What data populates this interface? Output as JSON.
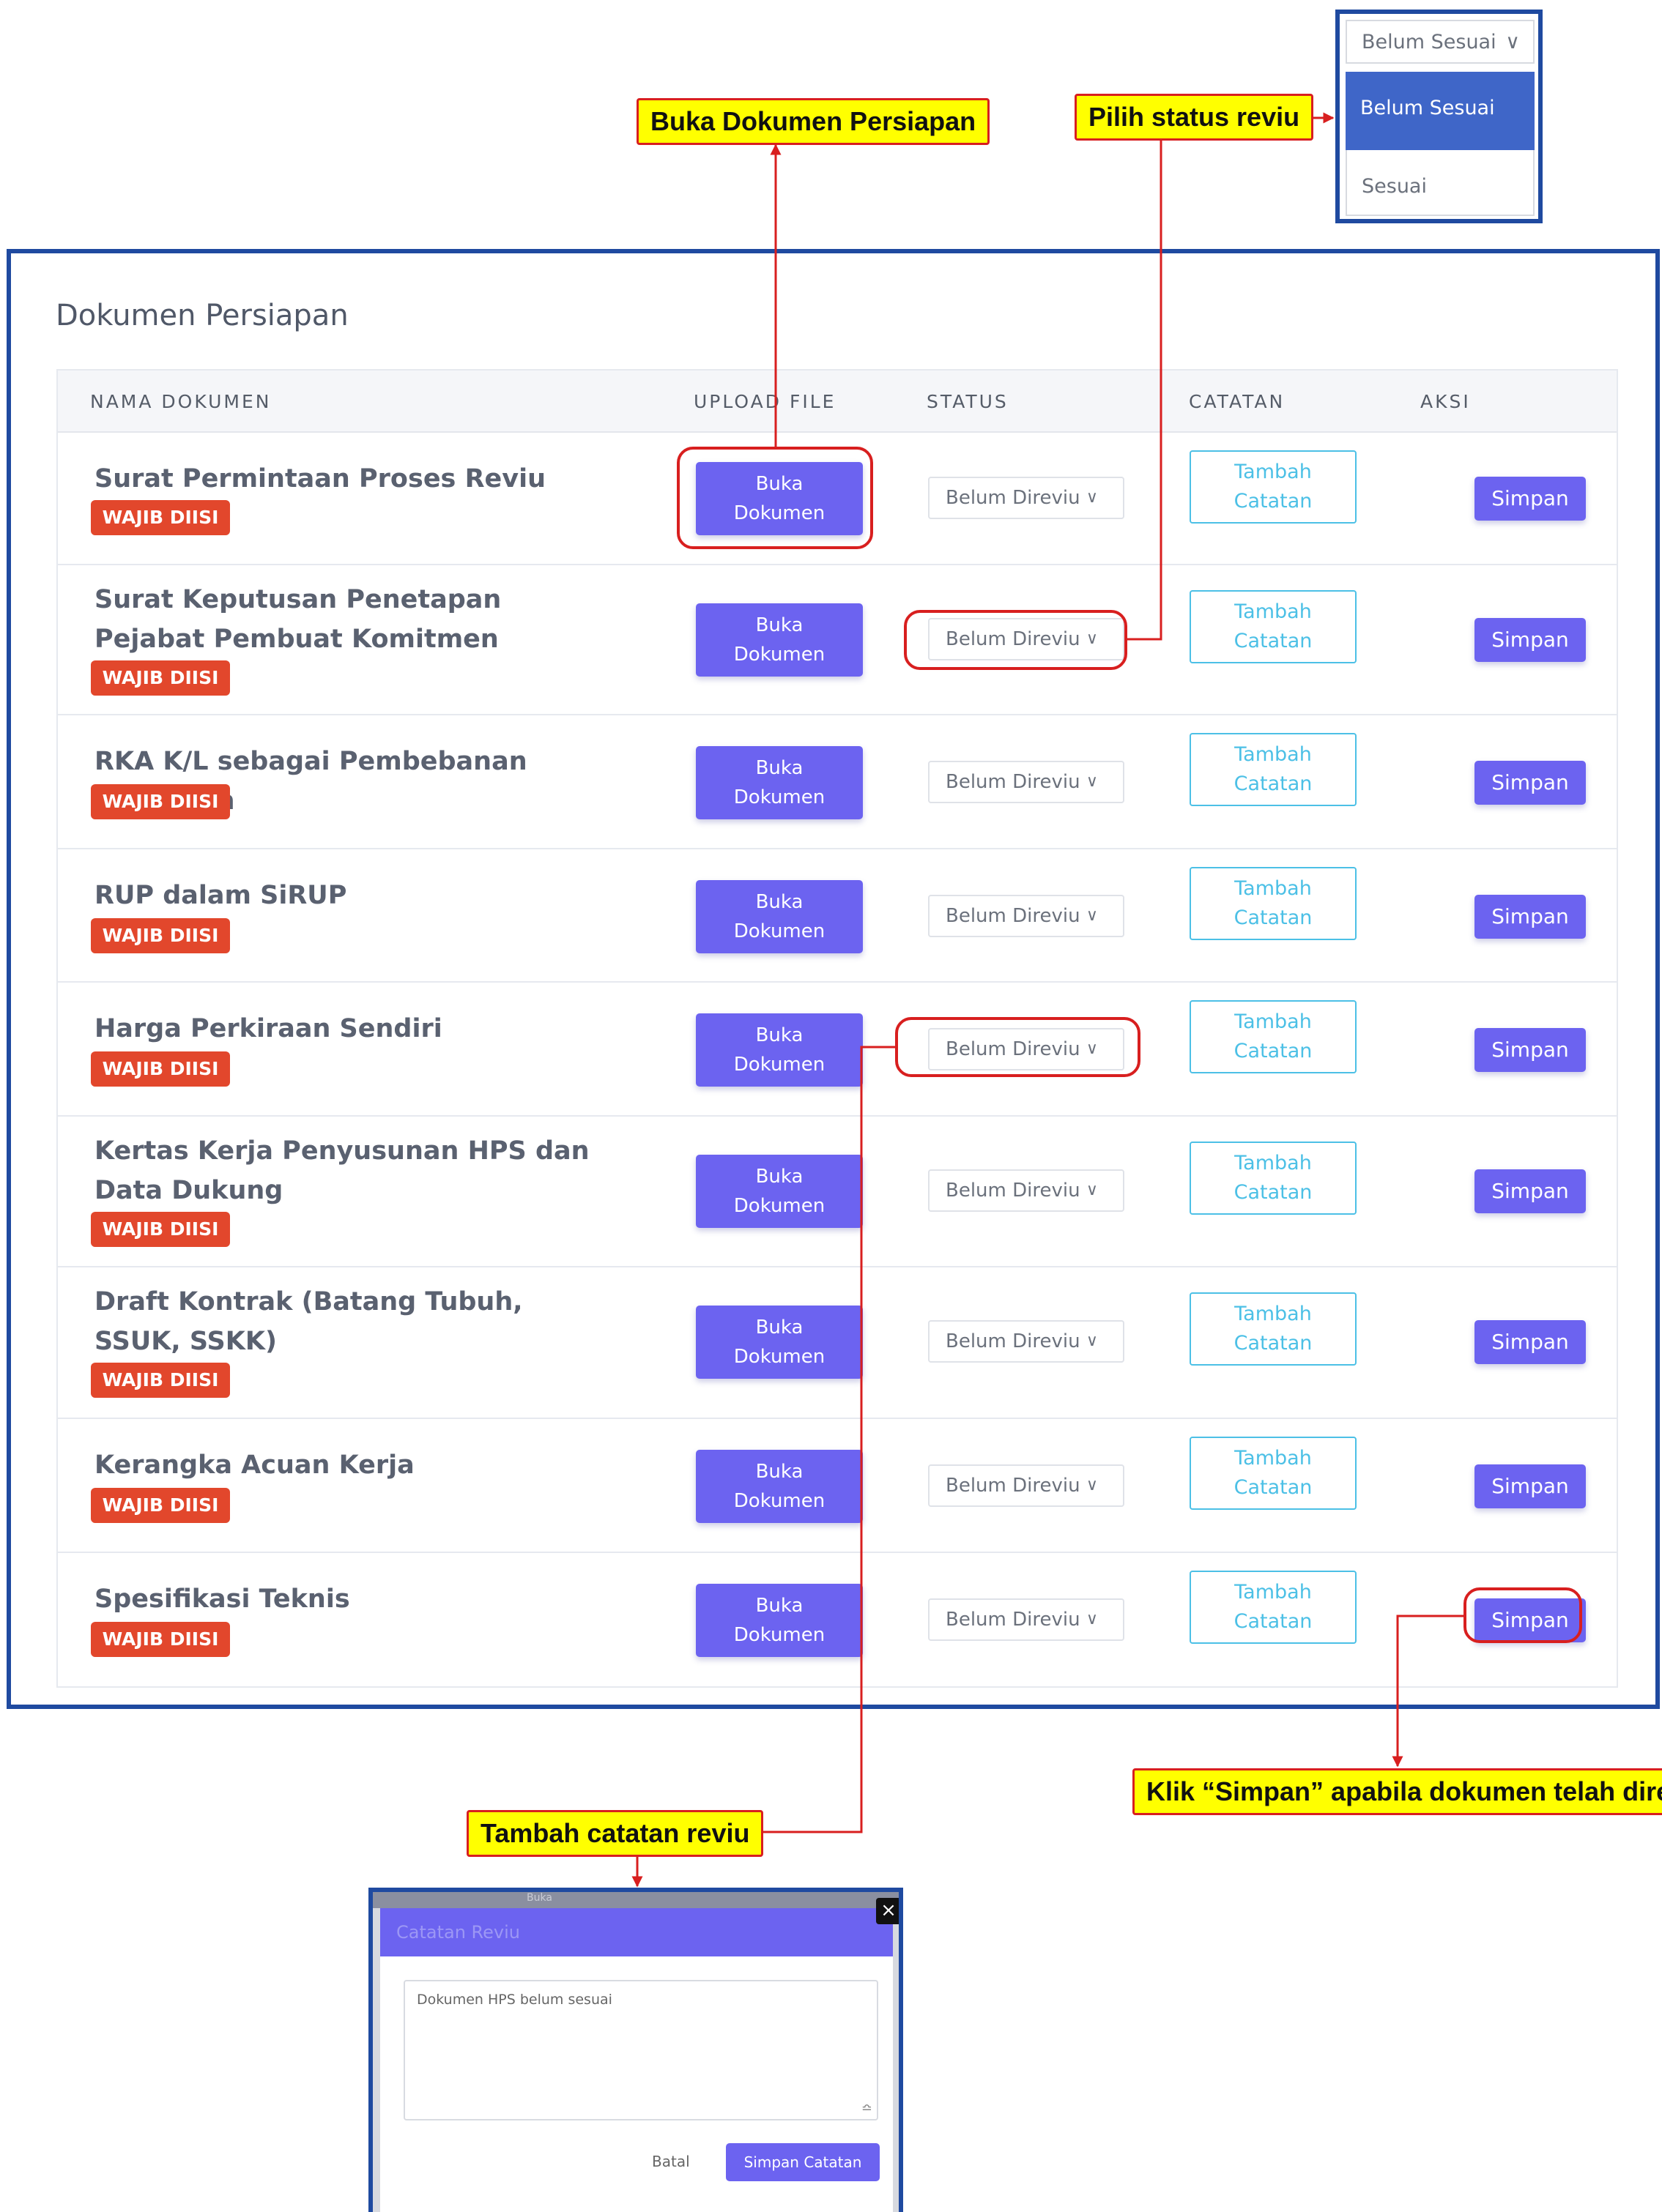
{
  "panel": {
    "title": "Dokumen Persiapan",
    "columns": [
      "NAMA DOKUMEN",
      "UPLOAD FILE",
      "STATUS",
      "CATATAN",
      "AKSI"
    ]
  },
  "row_common": {
    "badge": "WAJIB DIISI",
    "open_line1": "Buka",
    "open_line2": "Dokumen",
    "status": "Belum Direviu",
    "note_line1": "Tambah",
    "note_line2": "Catatan",
    "save": "Simpan"
  },
  "rows": [
    {
      "name": "Surat Permintaan Proses Reviu"
    },
    {
      "name": "Surat Keputusan Penetapan Pejabat Pembuat Komitmen"
    },
    {
      "name": "RKA K/L sebagai Pembebanan Anggaran"
    },
    {
      "name": "RUP dalam SiRUP"
    },
    {
      "name": "Harga Perkiraan Sendiri"
    },
    {
      "name": "Kertas Kerja Penyusunan HPS dan Data Dukung"
    },
    {
      "name": "Draft Kontrak (Batang Tubuh, SSUK, SSKK)"
    },
    {
      "name": "Kerangka Acuan Kerja"
    },
    {
      "name": "Spesifikasi Teknis"
    }
  ],
  "callouts": {
    "open_doc": "Buka Dokumen Persiapan",
    "pick_status": "Pilih status reviu",
    "add_note": "Tambah catatan reviu",
    "click_save": "Klik “Simpan” apabila dokumen telah direviu"
  },
  "dropdown": {
    "selected": "Belum Sesuai",
    "options": [
      "Belum Sesuai",
      "Sesuai"
    ]
  },
  "modal": {
    "behind_text": "Buka",
    "title": "Catatan Reviu",
    "textarea_value": "Dokumen HPS belum sesuai",
    "cancel": "Batal",
    "save": "Simpan Catatan",
    "close": "×"
  },
  "colors": {
    "primary": "#6c63f0",
    "badge_red": "#e2472c",
    "info_cyan": "#4cc0e6",
    "frame_blue": "#1f4aa0",
    "callout_yellow": "#ffff00",
    "callout_red": "#d81f1f",
    "option_blue": "#3f66c8"
  },
  "icons": {
    "status_chevron": "chevron-down-icon",
    "modal_close": "close-icon",
    "textarea_resize": "resize-grip-icon"
  }
}
